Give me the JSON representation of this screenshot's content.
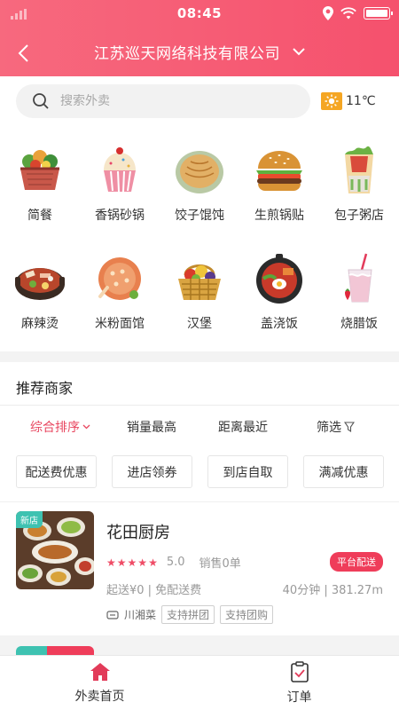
{
  "status_bar": {
    "time": "08:45"
  },
  "header": {
    "company_name": "江苏巡天网络科技有限公司"
  },
  "search": {
    "placeholder": "搜索外卖"
  },
  "weather": {
    "temperature": "11℃",
    "icon": "sun-icon"
  },
  "categories": [
    {
      "label": "简餐",
      "icon": "basket-meal-icon"
    },
    {
      "label": "香锅砂锅",
      "icon": "cupcake-icon"
    },
    {
      "label": "饺子馄饨",
      "icon": "pancake-plate-icon"
    },
    {
      "label": "生煎锅贴",
      "icon": "burger-icon"
    },
    {
      "label": "包子粥店",
      "icon": "wrap-icon"
    },
    {
      "label": "麻辣烫",
      "icon": "hotpot-icon"
    },
    {
      "label": "米粉面馆",
      "icon": "noodle-plate-icon"
    },
    {
      "label": "汉堡",
      "icon": "fruit-basket-icon"
    },
    {
      "label": "盖浇饭",
      "icon": "rice-bowl-icon"
    },
    {
      "label": "烧腊饭",
      "icon": "milkshake-icon"
    }
  ],
  "section": {
    "title": "推荐商家"
  },
  "sort_options": [
    "综合排序",
    "销量最高",
    "距离最近",
    "筛选"
  ],
  "filters": [
    "配送费优惠",
    "进店领券",
    "到店自取",
    "满减优惠"
  ],
  "shop": {
    "badge_new": "新店",
    "name": "花田厨房",
    "rating_stars": 5,
    "score": "5.0",
    "sales": "销售0单",
    "delivery_badge": "平台配送",
    "min_order": "起送¥0 | 免配送费",
    "time_distance": "40分钟 | 381.27m",
    "cuisine": "川湘菜",
    "tags": [
      "支持拼团",
      "支持团购"
    ]
  },
  "tabbar": [
    {
      "label": "外卖首页",
      "icon": "home-icon",
      "active": true
    },
    {
      "label": "订单",
      "icon": "order-clipboard-icon",
      "active": false
    }
  ],
  "colors": {
    "brand": "#f5516d",
    "accent": "#ef3d5a",
    "new_tag": "#3ec2b1"
  }
}
